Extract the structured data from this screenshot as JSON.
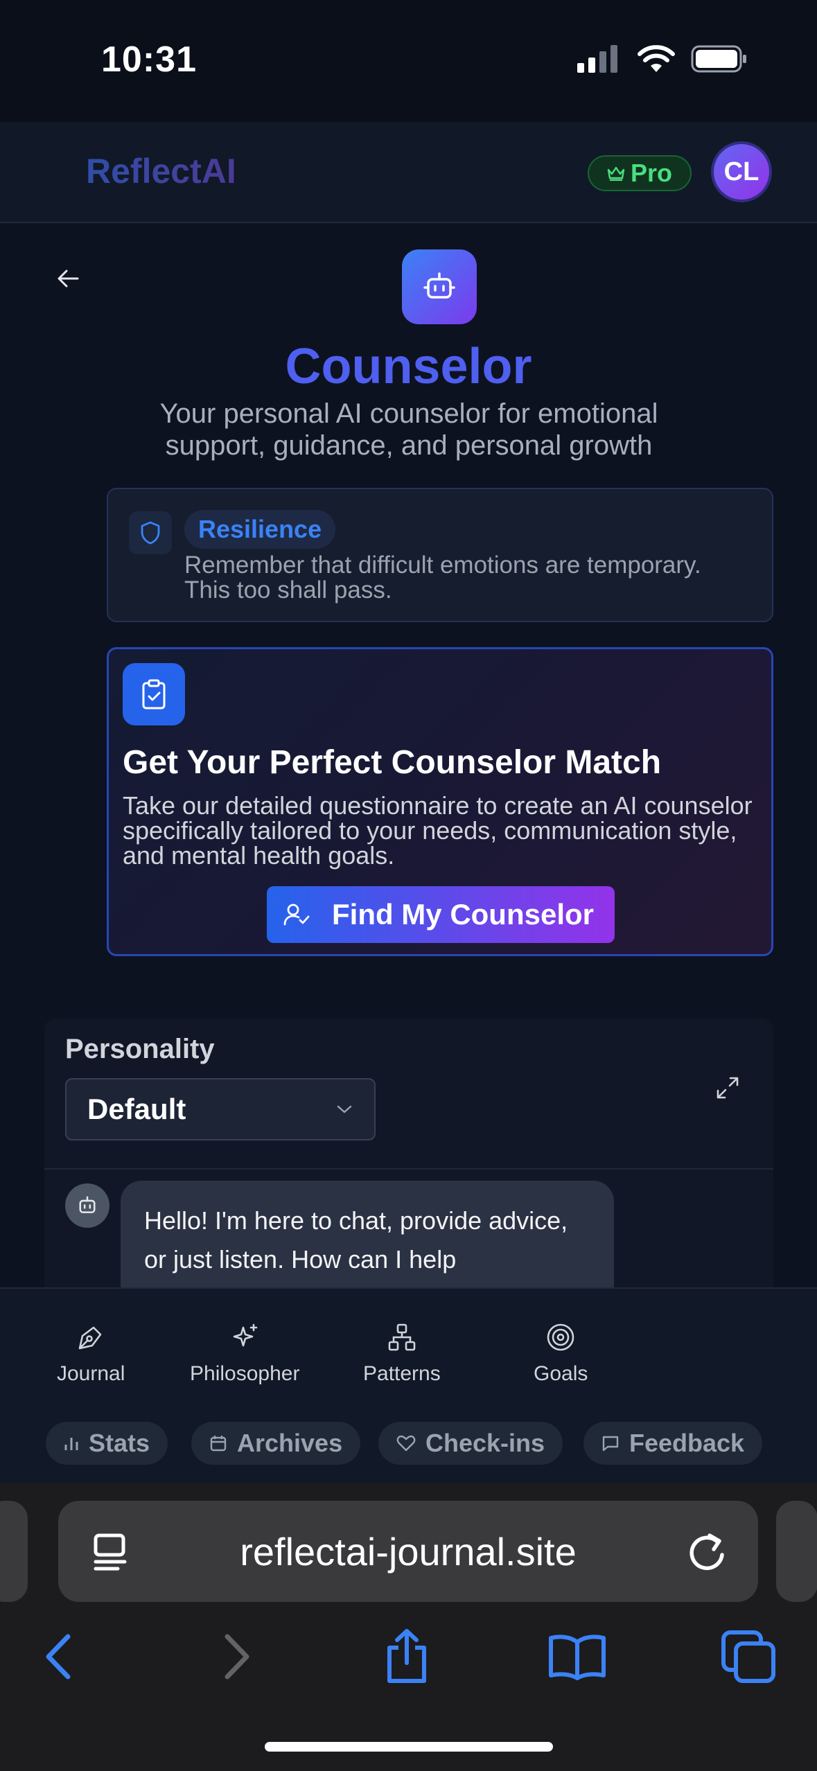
{
  "status_bar": {
    "time": "10:31",
    "icons": [
      "cellular-signal-icon",
      "wifi-icon",
      "battery-icon"
    ]
  },
  "header": {
    "brand": "ReflectAI",
    "pro_label": "Pro",
    "avatar_initials": "CL"
  },
  "hero": {
    "title": "Counselor",
    "subtitle": "Your personal AI counselor for emotional support, guidance, and personal growth"
  },
  "quote": {
    "tag": "Resilience",
    "text": "Remember that difficult emotions are temporary. This too shall pass."
  },
  "match_card": {
    "title": "Get Your Perfect Counselor Match",
    "text": "Take our detailed questionnaire to create an AI counselor specifically tailored to your needs, communication style, and mental health goals.",
    "button_label": "Find My Counselor"
  },
  "chat": {
    "personality_label": "Personality",
    "personality_value": "Default",
    "bot_message": "Hello! I'm here to chat, provide advice, or just listen. How can I help"
  },
  "bottom_nav": {
    "items": [
      {
        "label": "Journal",
        "icon": "pen-icon"
      },
      {
        "label": "Philosopher",
        "icon": "sparkles-icon"
      },
      {
        "label": "Patterns",
        "icon": "network-icon"
      },
      {
        "label": "Goals",
        "icon": "target-icon"
      }
    ],
    "chips": [
      {
        "label": "Stats",
        "icon": "bar-chart-icon"
      },
      {
        "label": "Archives",
        "icon": "calendar-icon"
      },
      {
        "label": "Check-ins",
        "icon": "heart-icon"
      },
      {
        "label": "Feedback",
        "icon": "message-icon"
      }
    ]
  },
  "browser": {
    "url": "reflectai-journal.site"
  },
  "colors": {
    "accent_blue": "#2563eb",
    "accent_purple": "#9333ea",
    "pro_green": "#4ade80",
    "safari_blue": "#3b82f6"
  }
}
